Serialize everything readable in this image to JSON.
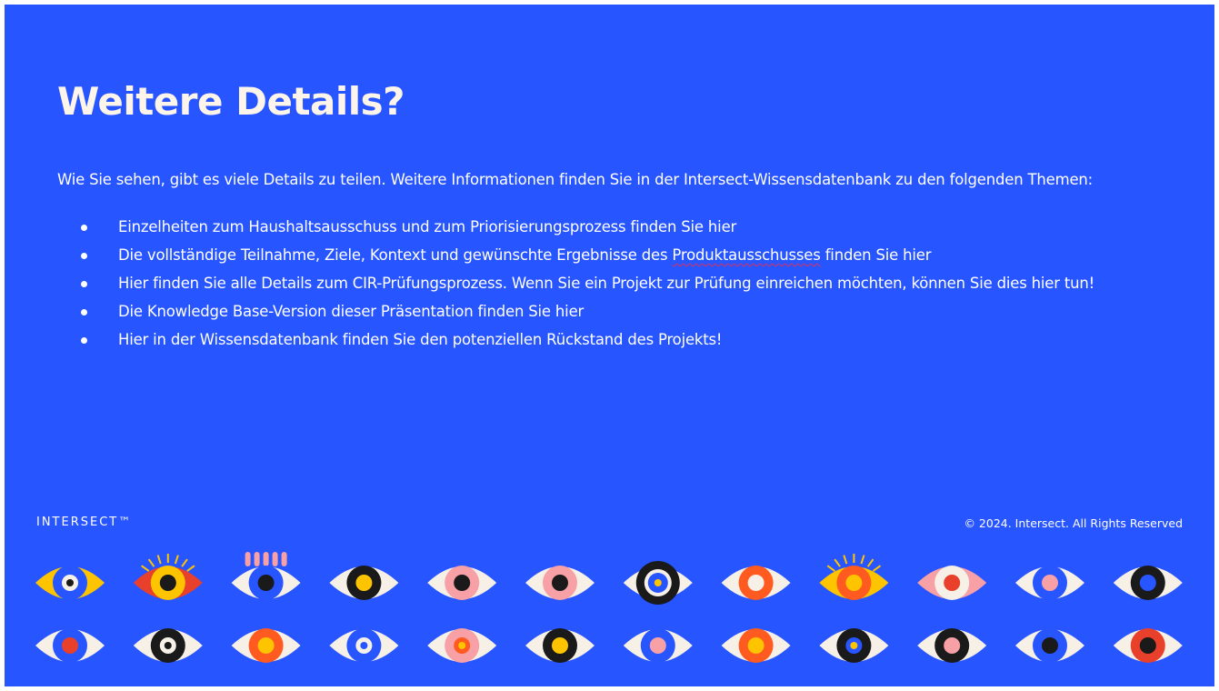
{
  "slide": {
    "title": "Weitere Details?",
    "intro": "Wie Sie sehen, gibt es viele Details zu teilen. Weitere Informationen finden Sie in der Intersect-Wissensdatenbank zu den folgenden Themen:",
    "bullets": [
      {
        "before": "Einzelheiten zum Haushaltsausschuss und zum Priorisierungsprozess finden Sie hier",
        "marked": "",
        "after": ""
      },
      {
        "before": "Die vollständige Teilnahme, Ziele, Kontext und gewünschte Ergebnisse des ",
        "marked": "Produktausschusses",
        "after": " finden Sie hier"
      },
      {
        "before": "Hier finden Sie alle Details zum CIR-Prüfungsprozess. Wenn Sie ein Projekt zur Prüfung einreichen möchten, können Sie dies hier tun!",
        "marked": "",
        "after": ""
      },
      {
        "before": "Die Knowledge Base-Version dieser Präsentation finden Sie hier",
        "marked": "",
        "after": ""
      },
      {
        "before": "Hier in der Wissensdatenbank finden Sie den potenziellen Rückstand des Projekts!",
        "marked": "",
        "after": ""
      }
    ],
    "logo_text": "INTERSECT™",
    "copyright": "© 2024. Intersect. All Rights Reserved"
  },
  "colors": {
    "background": "#2755ff",
    "title": "#fdf4ea",
    "text": "#ffffff",
    "spellcheck": "#e0305a"
  },
  "decor": {
    "icon": "eye-illustration-icon",
    "rows": 2,
    "per_row": 12
  }
}
